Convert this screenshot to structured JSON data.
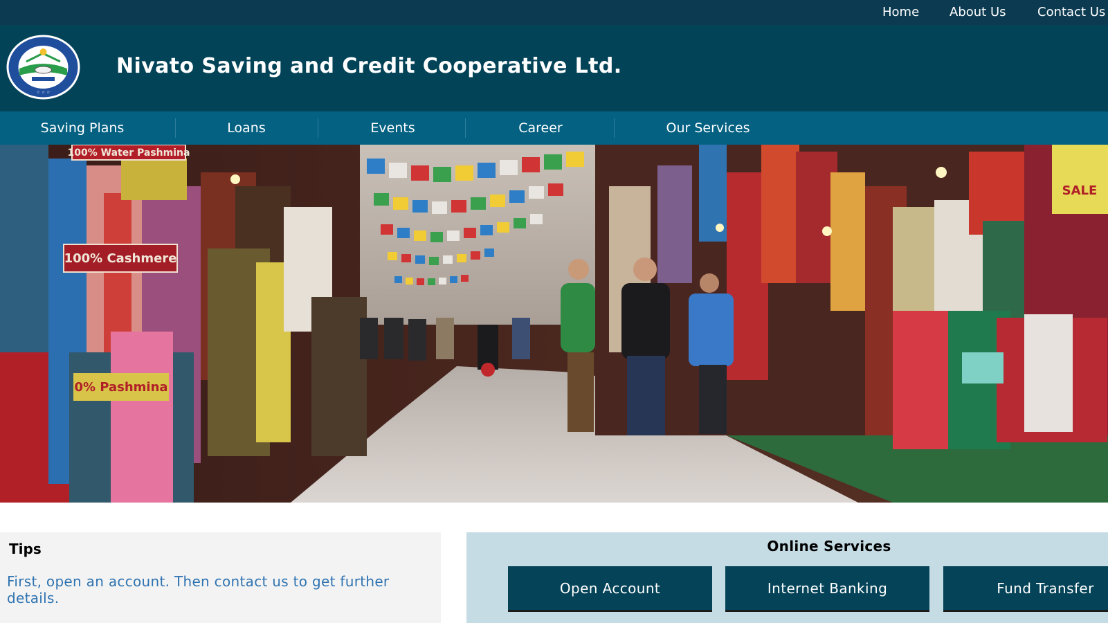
{
  "topbar": {
    "links": [
      {
        "label": "Home"
      },
      {
        "label": "About Us"
      },
      {
        "label": "Contact Us"
      }
    ]
  },
  "header": {
    "title": "Nivato Saving and Credit Cooperative Ltd.",
    "logo_icon": "cooperative-seal-logo"
  },
  "nav": {
    "items": [
      {
        "label": "Saving Plans"
      },
      {
        "label": "Loans"
      },
      {
        "label": "Events"
      },
      {
        "label": "Career"
      },
      {
        "label": "Our Services"
      }
    ]
  },
  "hero": {
    "signs": {
      "water_pashmina": "100% Water Pashmina",
      "cashmere": "100% Cashmere",
      "pashmina": "0% Pashmina",
      "sale": "SALE"
    }
  },
  "tips": {
    "title": "Tips",
    "body": "First, open an account. Then contact us to get further details."
  },
  "online_services": {
    "title": "Online Services",
    "buttons": [
      {
        "label": "Open Account"
      },
      {
        "label": "Internet Banking"
      },
      {
        "label": "Fund Transfer"
      }
    ]
  },
  "colors": {
    "topbar": "#0c3a51",
    "header": "#034358",
    "nav": "#046182",
    "tips_text": "#2f73b1",
    "online_bg": "#c5dce5",
    "button_bg": "#044358"
  }
}
